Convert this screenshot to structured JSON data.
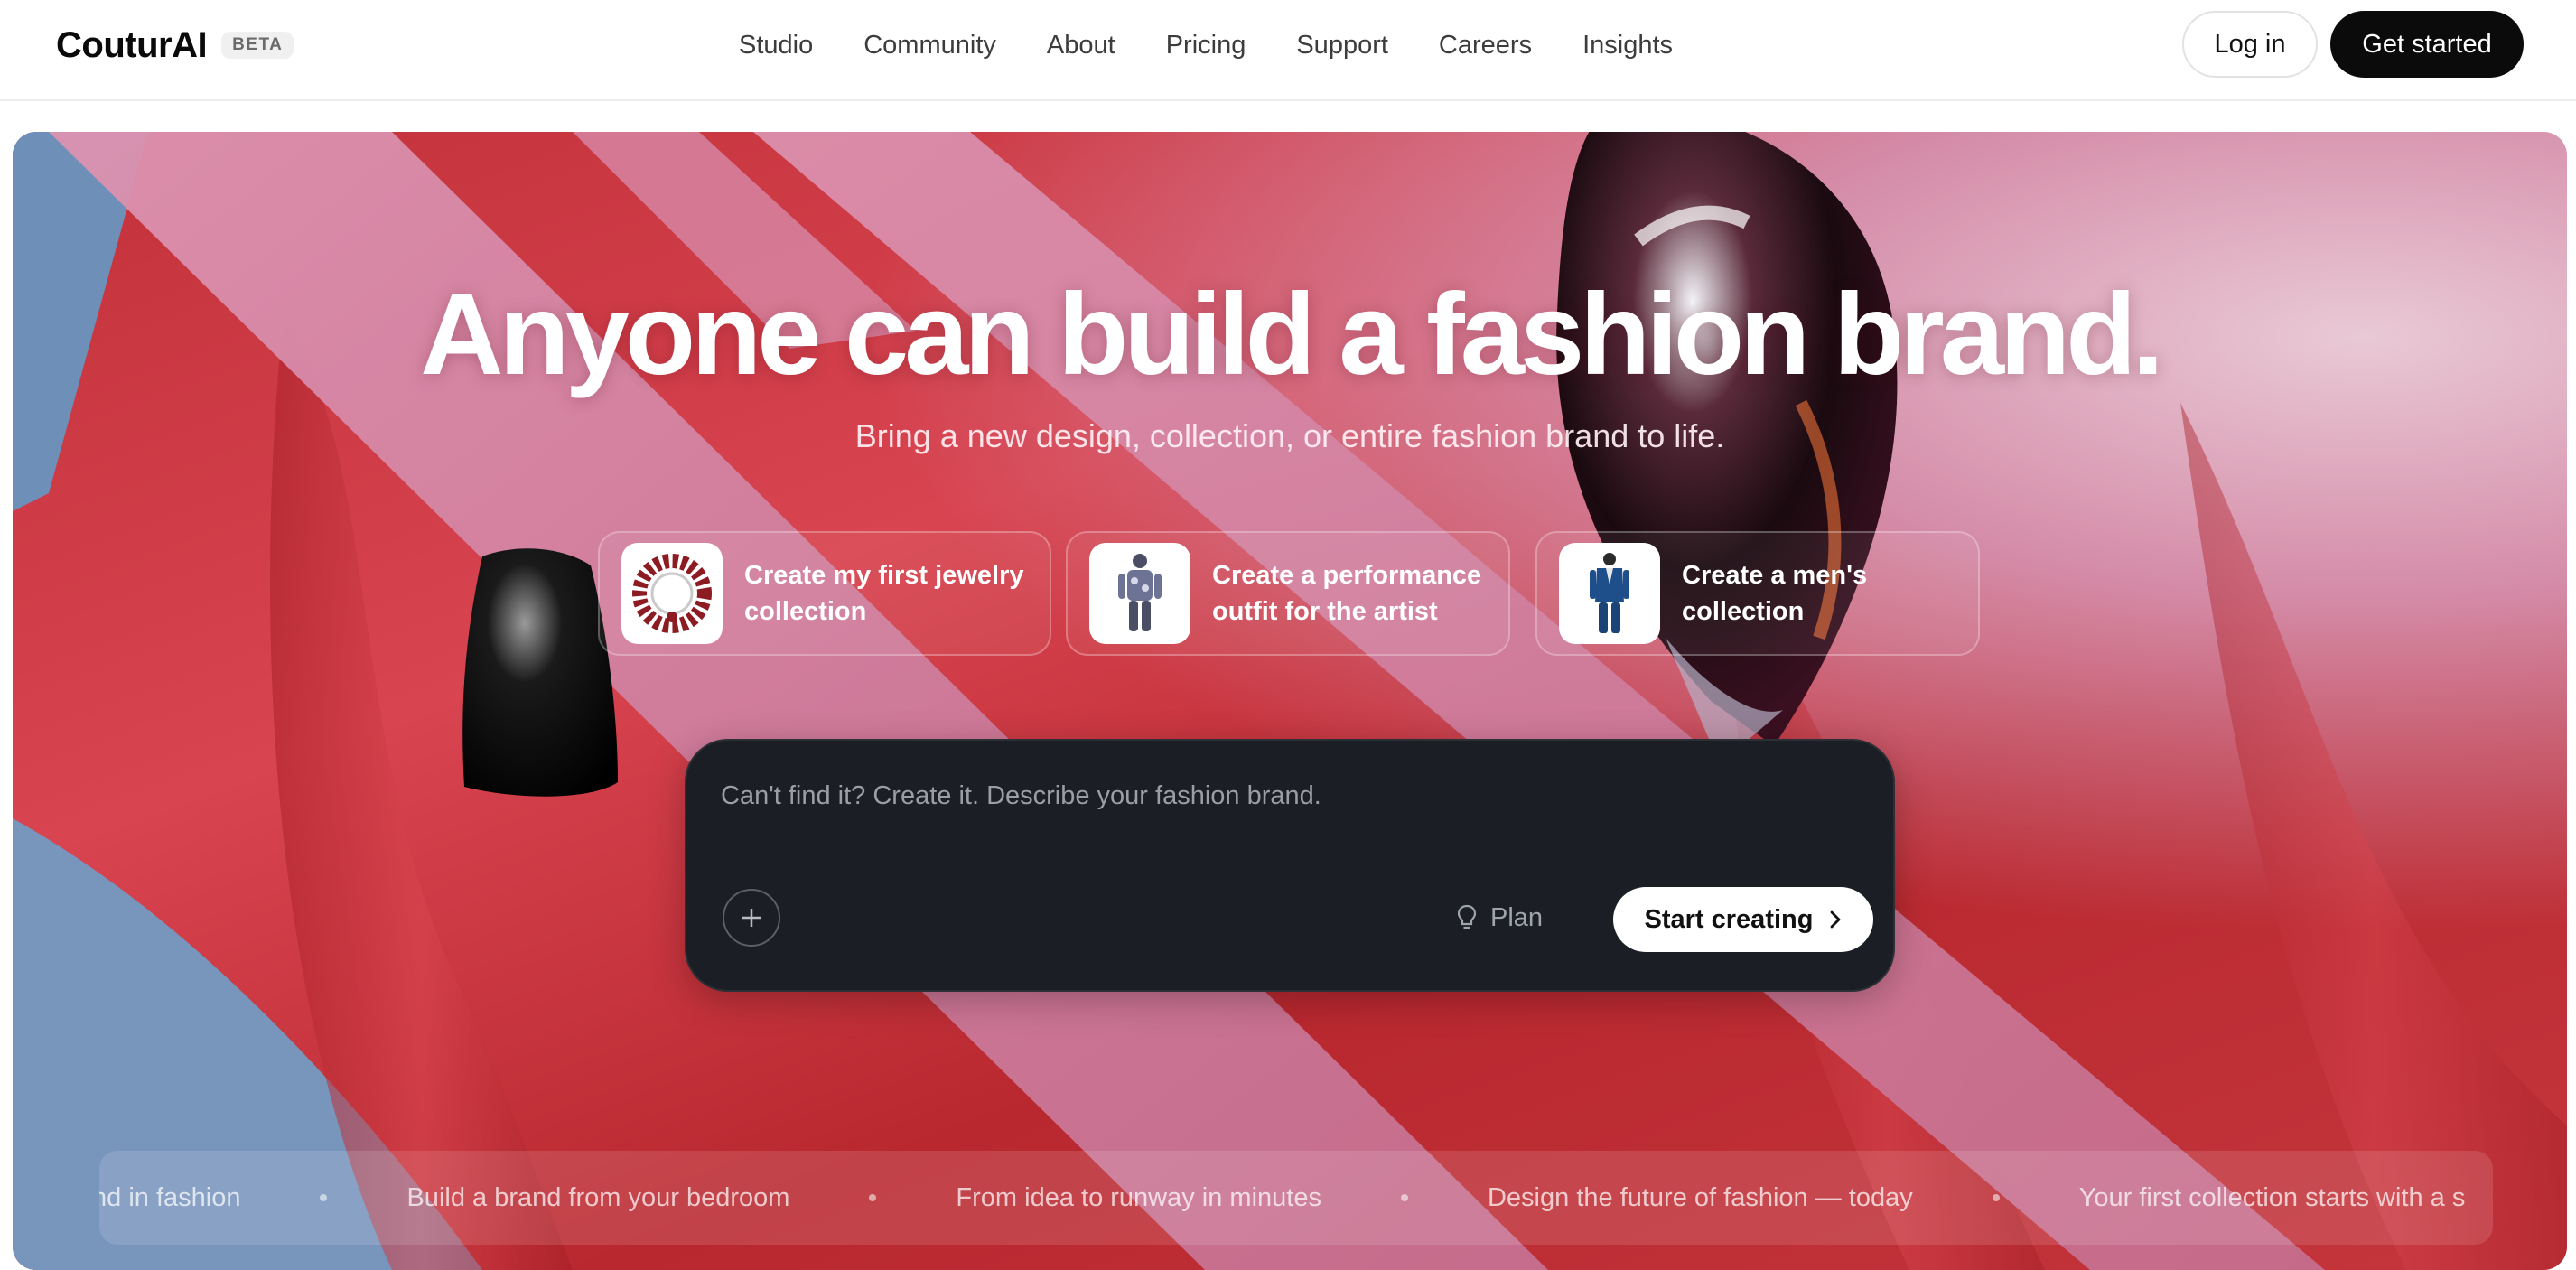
{
  "header": {
    "brand": "CouturAI",
    "badge": "BETA",
    "nav": [
      {
        "label": "Studio"
      },
      {
        "label": "Community"
      },
      {
        "label": "About"
      },
      {
        "label": "Pricing"
      },
      {
        "label": "Support"
      },
      {
        "label": "Careers"
      },
      {
        "label": "Insights"
      }
    ],
    "login_label": "Log in",
    "get_started_label": "Get started"
  },
  "hero": {
    "headline": "Anyone can build a fashion brand.",
    "subhead": "Bring a new design, collection, or entire fashion brand to life.",
    "suggestions": [
      {
        "label": "Create my first jewelry collection",
        "thumb_icon": "jewelry-necklace-icon"
      },
      {
        "label": "Create a performance outfit for the artist",
        "thumb_icon": "performance-outfit-icon"
      },
      {
        "label": "Create a men's collection",
        "thumb_icon": "mens-suit-icon"
      }
    ],
    "prompt": {
      "placeholder": "Can't find it? Create it. Describe your fashion brand.",
      "plan_label": "Plan",
      "start_label": "Start creating"
    },
    "ticker": [
      "nd in fashion",
      "Build a brand from your bedroom",
      "From idea to runway in minutes",
      "Design the future of fashion — today",
      "Your first collection starts with a s"
    ]
  },
  "colors": {
    "accent": "#0b0b0b",
    "hero_red": "#c2313a",
    "ribbon_pink": "#d98aa8",
    "prompt_bg": "#1b1e24"
  }
}
